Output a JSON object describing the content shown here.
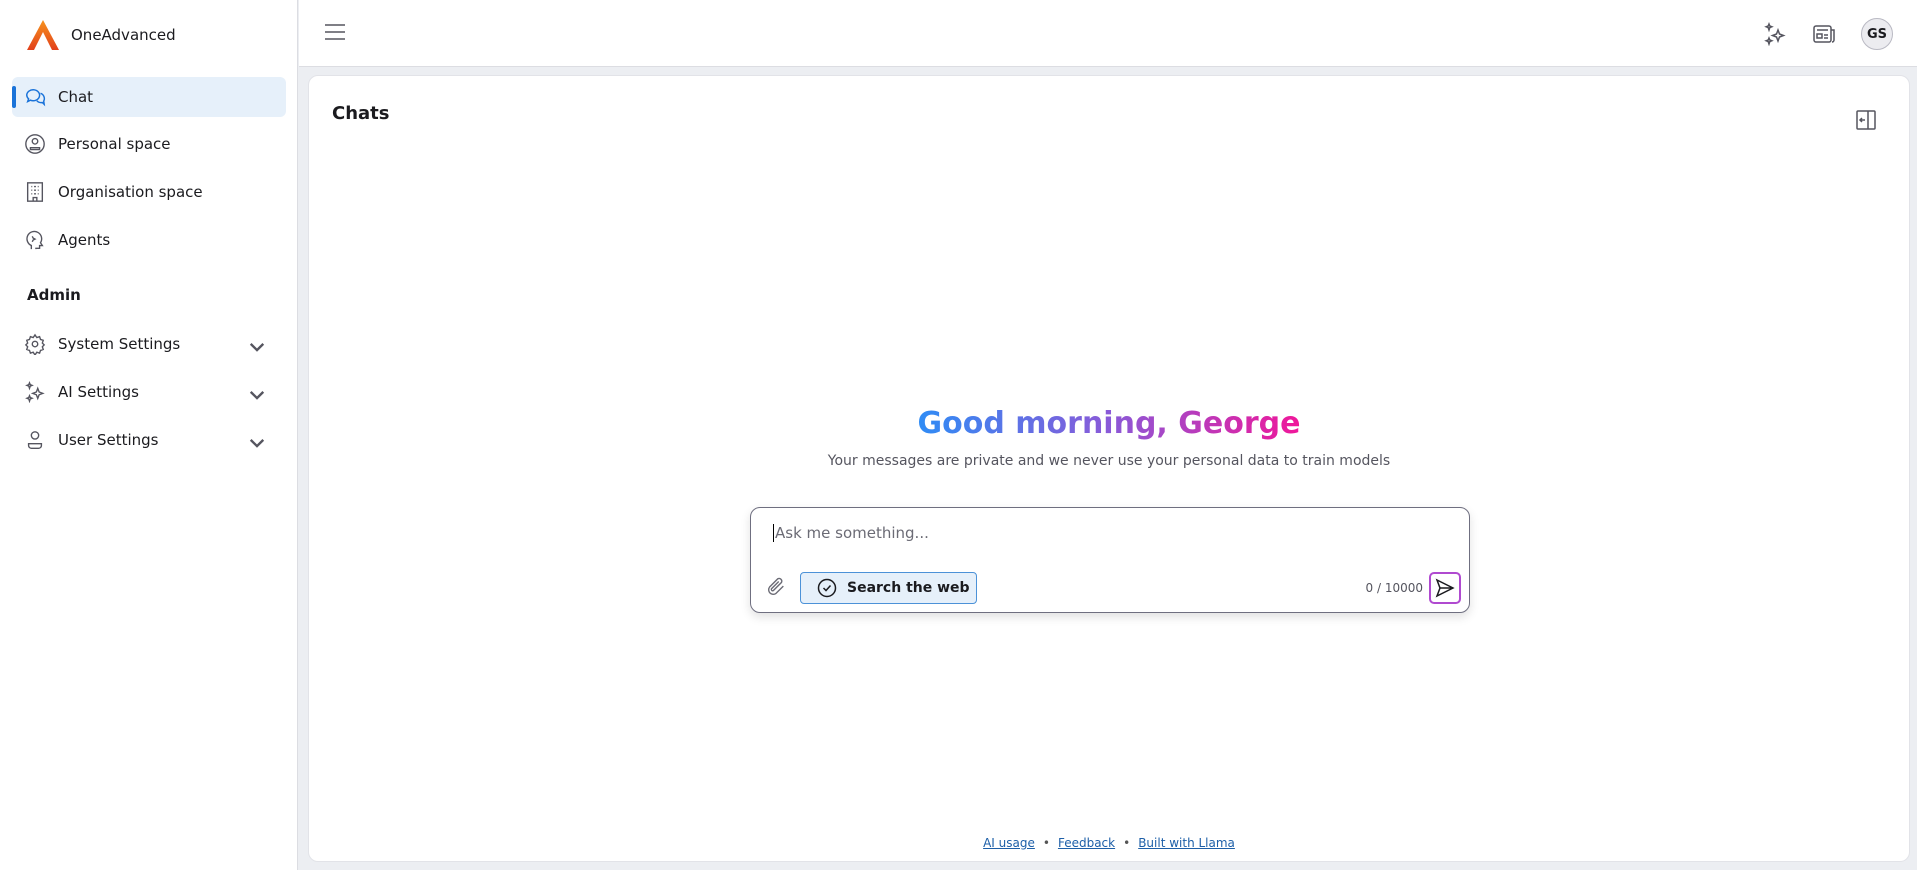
{
  "brand": {
    "name": "OneAdvanced"
  },
  "sidebar": {
    "items": [
      {
        "label": "Chat"
      },
      {
        "label": "Personal space"
      },
      {
        "label": "Organisation space"
      },
      {
        "label": "Agents"
      }
    ],
    "admin_heading": "Admin",
    "admin_items": [
      {
        "label": "System Settings"
      },
      {
        "label": "AI Settings"
      },
      {
        "label": "User Settings"
      }
    ]
  },
  "header": {
    "avatar_initials": "GS"
  },
  "main": {
    "title": "Chats",
    "greeting": "Good morning, George",
    "subtitle": "Your messages are private and we never use your personal data to train models",
    "input_placeholder": "Ask me something...",
    "search_web_label": "Search the web",
    "char_count": "0 / 10000"
  },
  "footer": {
    "links": [
      "AI usage",
      "Feedback",
      "Built with Llama"
    ]
  },
  "colors": {
    "accent": "#1a73d9",
    "gradient_start": "#2f8cf5",
    "gradient_end": "#f0179a"
  }
}
